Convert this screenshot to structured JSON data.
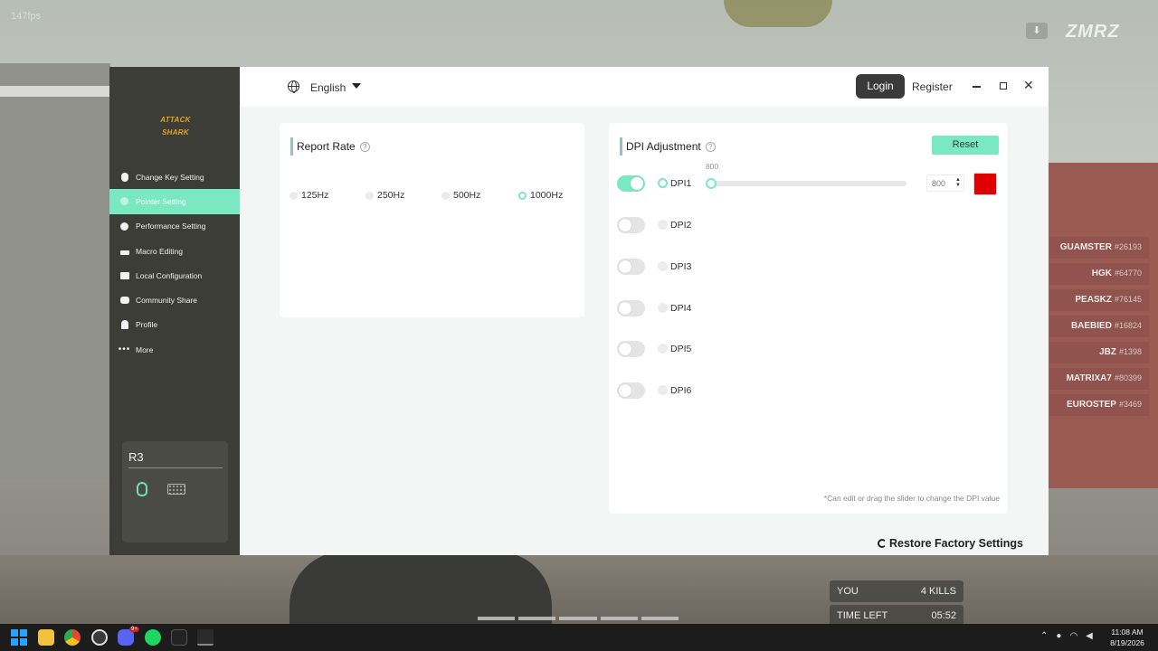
{
  "game": {
    "fps": "147fps",
    "brand_logo": "ZMRZ",
    "scoreboard": [
      {
        "name": "GUAMSTER",
        "tag": "#26193"
      },
      {
        "name": "HGK",
        "tag": "#64770"
      },
      {
        "name": "PEASKZ",
        "tag": "#76145"
      },
      {
        "name": "BAEBIED",
        "tag": "#16824"
      },
      {
        "name": "JBZ",
        "tag": "#1398"
      },
      {
        "name": "MATRIXA7",
        "tag": "#80399"
      },
      {
        "name": "EUROSTEP",
        "tag": "#3469"
      }
    ],
    "hud": {
      "you_label": "YOU",
      "kills": "4 KILLS",
      "time_label": "TIME LEFT",
      "time_value": "05:52"
    }
  },
  "app": {
    "logo_text": "ATTACK SHARK",
    "nav": [
      {
        "label": "Change Key Setting",
        "icon": "mouse-icon"
      },
      {
        "label": "Pointer Setting",
        "icon": "pointer-icon",
        "active": true
      },
      {
        "label": "Performance Setting",
        "icon": "gauge-icon"
      },
      {
        "label": "Macro Editing",
        "icon": "macro-icon"
      },
      {
        "label": "Local Configuration",
        "icon": "folder-icon"
      },
      {
        "label": "Community Share",
        "icon": "share-icon"
      },
      {
        "label": "Profile",
        "icon": "person-icon"
      },
      {
        "label": "More",
        "icon": "more-icon"
      }
    ],
    "device": {
      "name": "R3",
      "icons": [
        "mouse-icon",
        "keyboard-icon"
      ]
    },
    "topbar": {
      "language": "English",
      "login": "Login",
      "register": "Register",
      "close_glyph": "✕"
    },
    "report_rate": {
      "title": "Report Rate",
      "options": [
        "125Hz",
        "250Hz",
        "500Hz",
        "1000Hz"
      ],
      "selected": "1000Hz"
    },
    "dpi": {
      "title": "DPI Adjustment",
      "reset": "Reset",
      "rows": [
        {
          "label": "DPI1",
          "enabled": true,
          "selected": true,
          "value": "800",
          "slider_value": 800,
          "color": "#e00000"
        },
        {
          "label": "DPI2",
          "enabled": false
        },
        {
          "label": "DPI3",
          "enabled": false
        },
        {
          "label": "DPI4",
          "enabled": false
        },
        {
          "label": "DPI5",
          "enabled": false
        },
        {
          "label": "DPI6",
          "enabled": false
        }
      ],
      "hint": "*Can edit or drag the slider to change the DPI value"
    },
    "restore": "Restore Factory Settings",
    "accent_color": "#7be8c4"
  },
  "taskbar": {
    "apps": [
      "windows-start-icon",
      "file-explorer-icon",
      "chrome-icon",
      "obs-icon",
      "discord-icon",
      "spotify-icon",
      "nvidia-icon",
      "attack-shark-icon"
    ],
    "discord_badge": "9+",
    "time": "11:08 AM",
    "date": "8/19/2026"
  }
}
